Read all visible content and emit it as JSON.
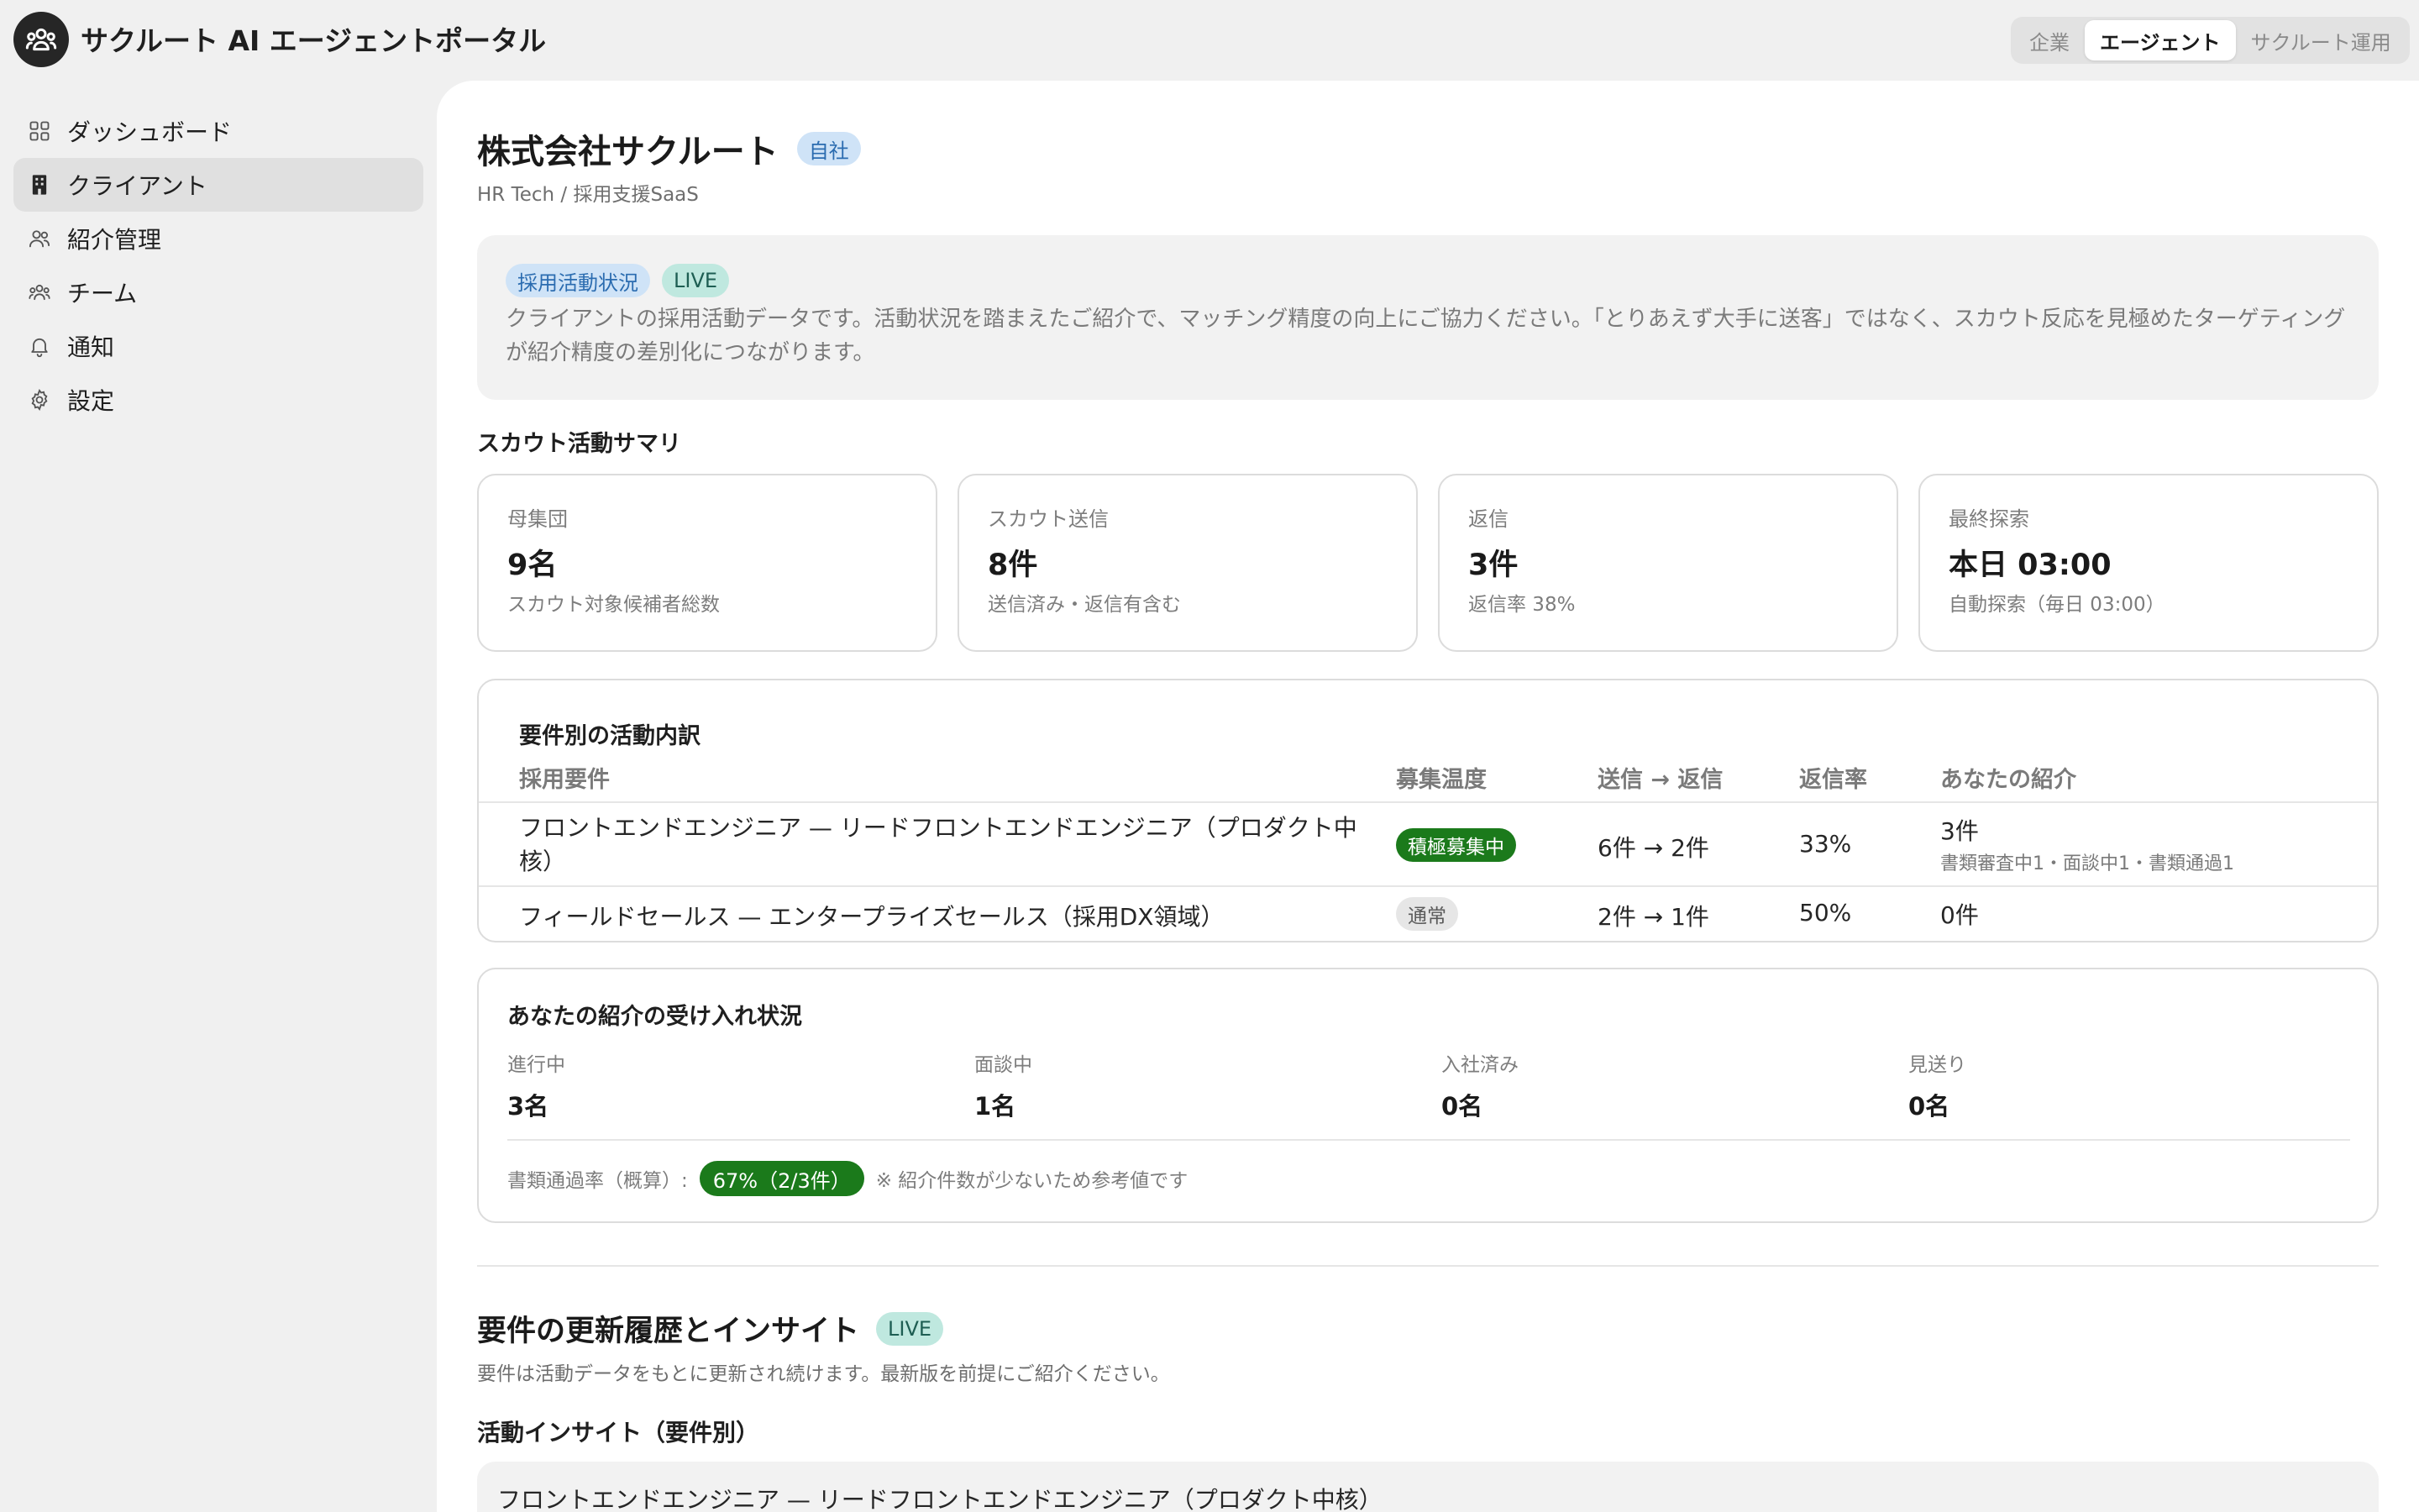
{
  "app": {
    "title": "サクルート AI エージェントポータル",
    "logo_icon": "team-icon"
  },
  "mode_switch": {
    "items": [
      {
        "label": "企業",
        "active": false
      },
      {
        "label": "エージェント",
        "active": true
      },
      {
        "label": "サクルート運用",
        "active": false
      }
    ]
  },
  "sidebar": {
    "items": [
      {
        "label": "ダッシュボード",
        "icon": "dashboard-grid-icon",
        "active": false
      },
      {
        "label": "クライアント",
        "icon": "building-icon",
        "active": true
      },
      {
        "label": "紹介管理",
        "icon": "users-icon",
        "active": false
      },
      {
        "label": "チーム",
        "icon": "team-icon",
        "active": false
      },
      {
        "label": "通知",
        "icon": "bell-icon",
        "active": false
      },
      {
        "label": "設定",
        "icon": "gear-icon",
        "active": false
      }
    ]
  },
  "company": {
    "name": "株式会社サクルート",
    "badge": "自社",
    "subtitle": "HR Tech / 採用支援SaaS"
  },
  "notice": {
    "tag": "採用活動状況",
    "live": "LIVE",
    "text": "クライアントの採用活動データです。活動状況を踏まえたご紹介で、マッチング精度の向上にご協力ください。「とりあえず大手に送客」ではなく、スカウト反応を見極めたターゲティングが紹介精度の差別化につながります。"
  },
  "scout_summary": {
    "title": "スカウト活動サマリ",
    "cards": [
      {
        "label": "母集団",
        "value": "9名",
        "note": "スカウト対象候補者総数"
      },
      {
        "label": "スカウト送信",
        "value": "8件",
        "note": "送信済み・返信有含む"
      },
      {
        "label": "返信",
        "value": "3件",
        "note": "返信率 38%"
      },
      {
        "label": "最終探索",
        "value": "本日 03:00",
        "note": "自動探索（毎日 03:00）"
      }
    ]
  },
  "breakdown": {
    "title": "要件別の活動内訳",
    "headers": {
      "req": "採用要件",
      "temp": "募集温度",
      "flow": "送信 → 返信",
      "rate": "返信率",
      "yours": "あなたの紹介"
    },
    "rows": [
      {
        "req_line1": "フロントエンドエンジニア — リードフロントエンドエンジニア（プロダクト中",
        "req_line2": "核）",
        "temp": "積極募集中",
        "temp_style": "green",
        "flow": "6件 → 2件",
        "rate": "33%",
        "yours": "3件",
        "yours_detail": "書類審査中1・面談中1・書類通過1"
      },
      {
        "req_line1": "フィールドセールス — エンタープライズセールス（採用DX領域）",
        "req_line2": "",
        "temp": "通常",
        "temp_style": "gray",
        "flow": "2件 → 1件",
        "rate": "50%",
        "yours": "0件",
        "yours_detail": ""
      }
    ]
  },
  "acceptance": {
    "title": "あなたの紹介の受け入れ状況",
    "stats": [
      {
        "label": "進行中",
        "value": "3名"
      },
      {
        "label": "面談中",
        "value": "1名"
      },
      {
        "label": "入社済み",
        "value": "0名"
      },
      {
        "label": "見送り",
        "value": "0名"
      }
    ],
    "pass_rate_label": "書類通過率（概算）:",
    "pass_rate_value": "67%（2/3件）",
    "pass_rate_note": "※ 紹介件数が少ないため参考値です"
  },
  "history": {
    "title": "要件の更新履歴とインサイト",
    "live": "LIVE",
    "subtitle": "要件は活動データをもとに更新され続けます。最新版を前提にご紹介ください。",
    "insight_title": "活動インサイト（要件別）",
    "first_item": "フロントエンドエンジニア — リードフロントエンドエンジニア（プロダクト中核）"
  }
}
